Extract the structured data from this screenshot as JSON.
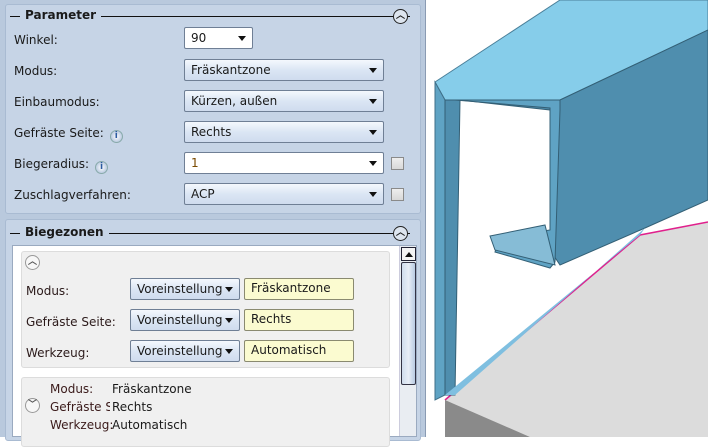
{
  "parameter": {
    "title": "Parameter",
    "collapse_icon": "chevron-up",
    "rows": [
      {
        "label": "Winkel:",
        "value": "90"
      },
      {
        "label": "Modus:",
        "value": "Fräskantzone"
      },
      {
        "label": "Einbaumodus:",
        "value": "Kürzen, außen"
      },
      {
        "label": "Gefräste Seite:",
        "value": "Rechts"
      },
      {
        "label": "Biegeradius:",
        "value": "1"
      },
      {
        "label": "Zuschlagverfahren:",
        "value": "ACP"
      }
    ],
    "info_glyph": "i"
  },
  "biegezonen": {
    "title": "Biegezonen",
    "card1": {
      "rows": [
        {
          "label": "Modus:",
          "mode": "Voreinstellung",
          "value": "Fräskantzone"
        },
        {
          "label": "Gefräste Seite:",
          "mode": "Voreinstellung",
          "value": "Rechts"
        },
        {
          "label": "Werkzeug:",
          "mode": "Voreinstellung",
          "value": "Automatisch"
        }
      ]
    },
    "card2": {
      "rows": [
        {
          "label": "Modus:",
          "value": "Fräskantzone"
        },
        {
          "label": "Gefräste Se",
          "value": "Rechts"
        },
        {
          "label": "Werkzeug:",
          "value": "Automatisch"
        }
      ]
    }
  },
  "colors": {
    "panel": "#c6d4e6",
    "field_highlight": "#fbfbd0",
    "model_blue": "#5fa3c4",
    "edge_magenta": "#e0208c"
  }
}
